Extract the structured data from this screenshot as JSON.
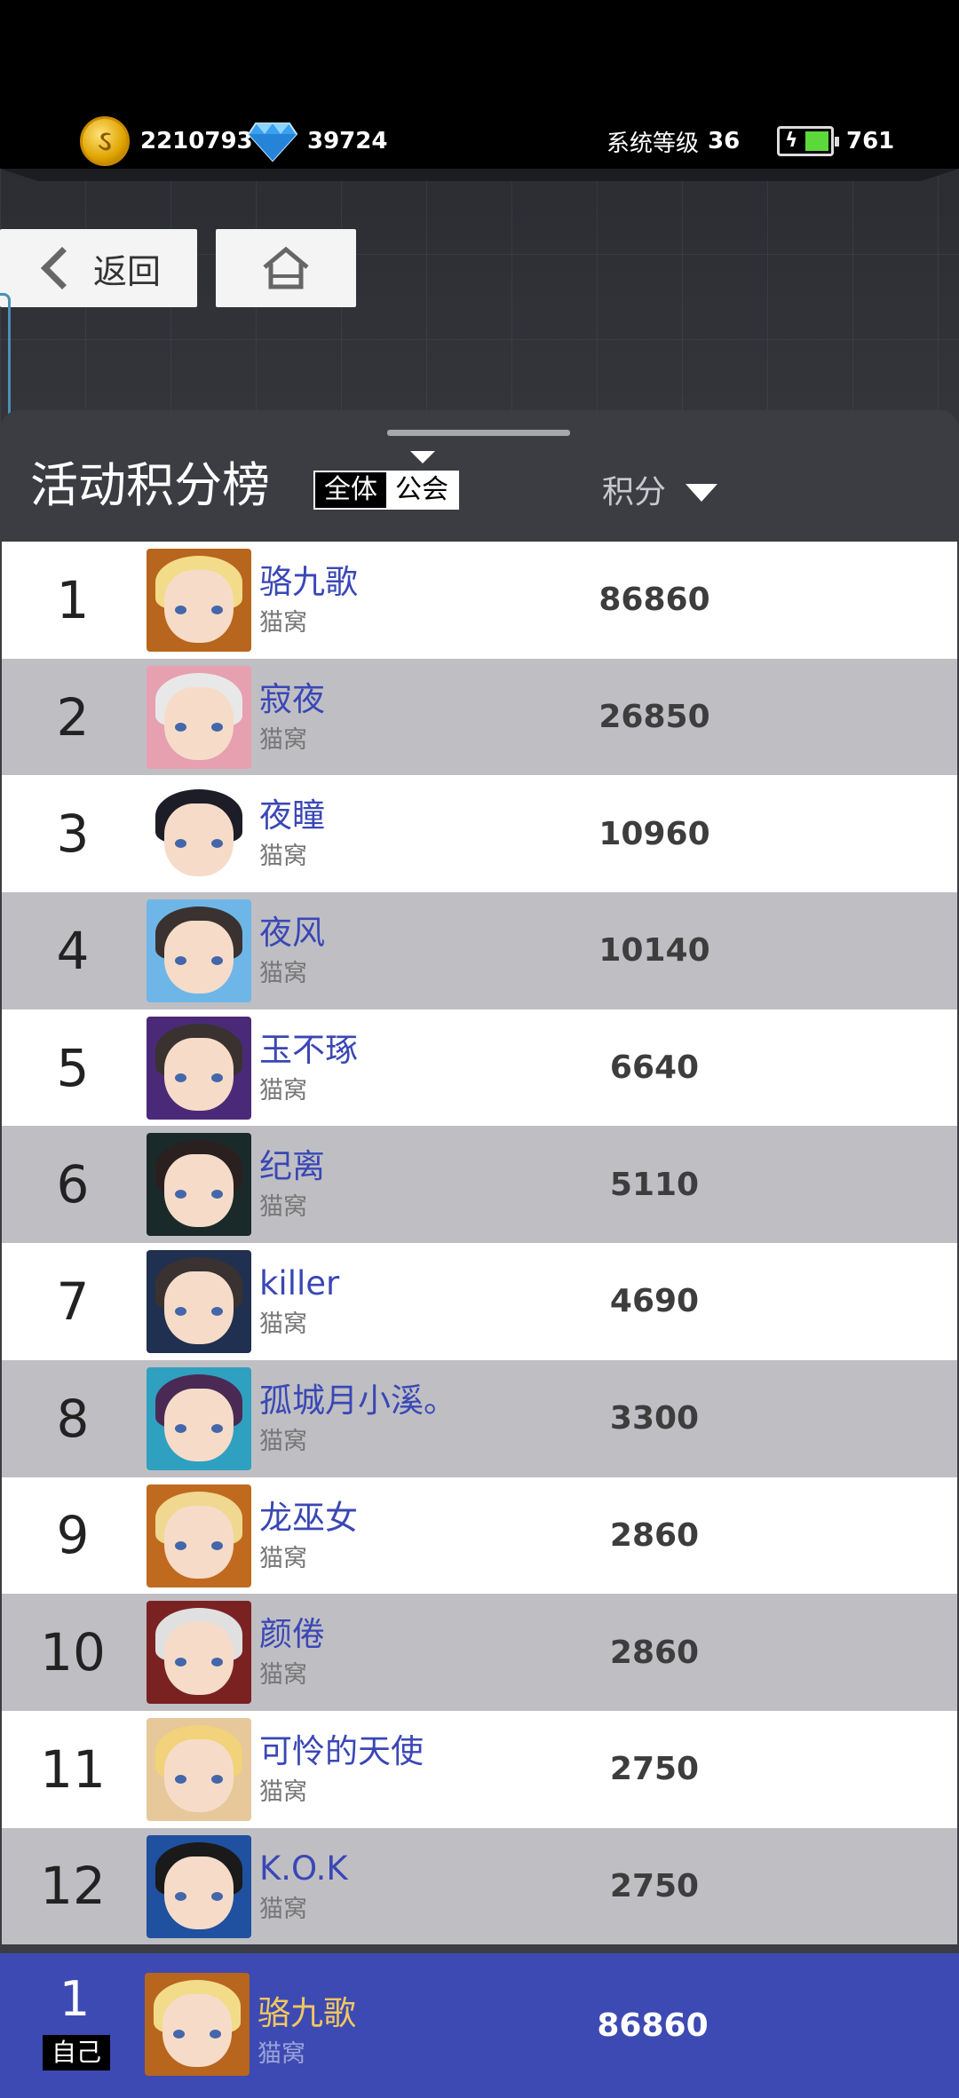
{
  "status_bar": {
    "coins": "2210793",
    "gems": "39724",
    "level_label": "系统等级",
    "level_value": "36",
    "energy": "761"
  },
  "nav": {
    "back_label": "返回"
  },
  "board": {
    "title": "活动积分榜",
    "toggle_all": "全体",
    "toggle_guild": "公会",
    "score_header": "积分"
  },
  "ranking": [
    {
      "rank": "1",
      "name": "骆九歌",
      "guild": "猫窝",
      "score": "86860",
      "hair": "#f2dc8a",
      "frame": "#b8651e"
    },
    {
      "rank": "2",
      "name": "寂夜",
      "guild": "猫窝",
      "score": "26850",
      "hair": "#e8e8e8",
      "frame": "#e7a0b0"
    },
    {
      "rank": "3",
      "name": "夜瞳",
      "guild": "猫窝",
      "score": "10960",
      "hair": "#1d1d28",
      "frame": "#ffffff"
    },
    {
      "rank": "4",
      "name": "夜风",
      "guild": "猫窝",
      "score": "10140",
      "hair": "#3a3230",
      "frame": "#6fb6e8"
    },
    {
      "rank": "5",
      "name": "玉不琢",
      "guild": "猫窝",
      "score": "6640",
      "hair": "#3a3230",
      "frame": "#4a2a78"
    },
    {
      "rank": "6",
      "name": "纪离",
      "guild": "猫窝",
      "score": "5110",
      "hair": "#2a2020",
      "frame": "#1a2a2a"
    },
    {
      "rank": "7",
      "name": "killer",
      "guild": "猫窝",
      "score": "4690",
      "hair": "#3a3230",
      "frame": "#203050"
    },
    {
      "rank": "8",
      "name": "孤城月小溪。",
      "guild": "猫窝",
      "score": "3300",
      "hair": "#4a2a55",
      "frame": "#30a0c0"
    },
    {
      "rank": "9",
      "name": "龙巫女",
      "guild": "猫窝",
      "score": "2860",
      "hair": "#f0d890",
      "frame": "#c06a20"
    },
    {
      "rank": "10",
      "name": "颜倦",
      "guild": "猫窝",
      "score": "2860",
      "hair": "#e0e0e0",
      "frame": "#7a2222"
    },
    {
      "rank": "11",
      "name": "可怜的天使",
      "guild": "猫窝",
      "score": "2750",
      "hair": "#f2d27a",
      "frame": "#e6c89a"
    },
    {
      "rank": "12",
      "name": "K.O.K",
      "guild": "猫窝",
      "score": "2750",
      "hair": "#1a1a1a",
      "frame": "#2050a0"
    }
  ],
  "self": {
    "rank": "1",
    "tag": "自己",
    "name": "骆九歌",
    "guild": "猫窝",
    "score": "86860",
    "hair": "#f2dc8a",
    "frame": "#b8651e"
  }
}
